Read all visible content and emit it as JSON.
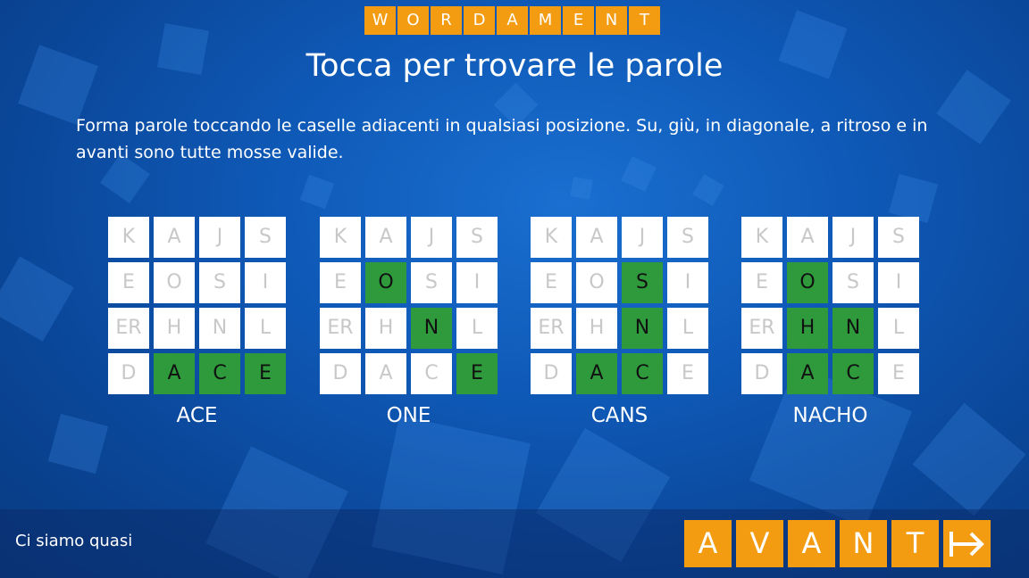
{
  "logo": {
    "letters": [
      "W",
      "O",
      "R",
      "D",
      "A",
      "M",
      "E",
      "N",
      "T"
    ]
  },
  "title": "Tocca per trovare le parole",
  "instructions": "Forma parole toccando le caselle adiacenti in qualsiasi posizione. Su, giù, in diagonale, a ritroso e in avanti sono tutte mosse valide.",
  "examples": [
    {
      "word": "ACE",
      "tiles": [
        "K",
        "A",
        "J",
        "S",
        "E",
        "O",
        "S",
        "I",
        "ER",
        "H",
        "N",
        "L",
        "D",
        "A",
        "C",
        "E"
      ],
      "highlighted": [
        13,
        14,
        15
      ]
    },
    {
      "word": "ONE",
      "tiles": [
        "K",
        "A",
        "J",
        "S",
        "E",
        "O",
        "S",
        "I",
        "ER",
        "H",
        "N",
        "L",
        "D",
        "A",
        "C",
        "E"
      ],
      "highlighted": [
        5,
        10,
        15
      ]
    },
    {
      "word": "CANS",
      "tiles": [
        "K",
        "A",
        "J",
        "S",
        "E",
        "O",
        "S",
        "I",
        "ER",
        "H",
        "N",
        "L",
        "D",
        "A",
        "C",
        "E"
      ],
      "highlighted": [
        6,
        10,
        13,
        14
      ]
    },
    {
      "word": "NACHO",
      "tiles": [
        "K",
        "A",
        "J",
        "S",
        "E",
        "O",
        "S",
        "I",
        "ER",
        "H",
        "N",
        "L",
        "D",
        "A",
        "C",
        "E"
      ],
      "highlighted": [
        5,
        9,
        10,
        13,
        14
      ]
    }
  ],
  "status": "Ci siamo quasi",
  "next_button": {
    "letters": [
      "A",
      "V",
      "A",
      "N",
      "T"
    ],
    "icon": "next-arrow-icon"
  },
  "colors": {
    "accent": "#f39c12",
    "highlight": "#2e9a3c",
    "background": "#0f5ab8"
  }
}
